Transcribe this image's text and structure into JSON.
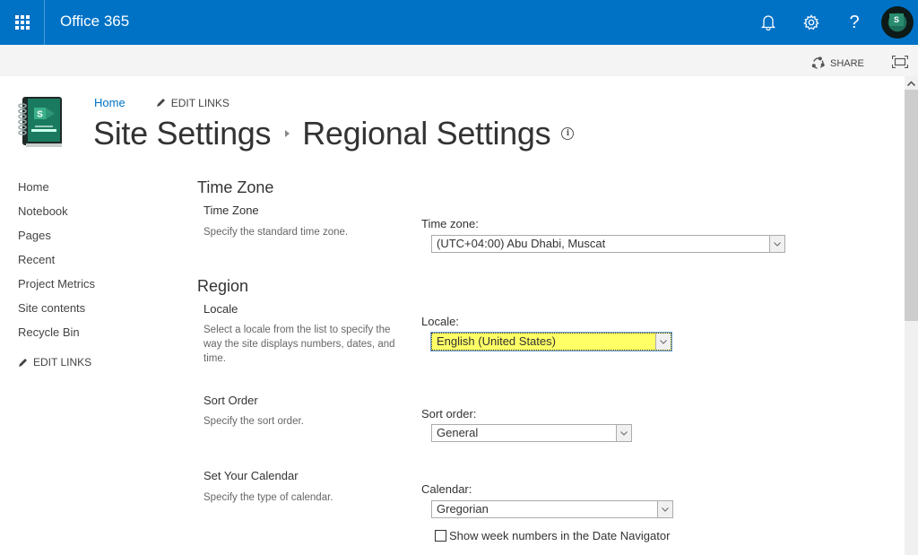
{
  "suitebar": {
    "app_title": "Office 365",
    "icons": [
      "waffle-icon",
      "bell-icon",
      "gear-icon",
      "help-icon",
      "avatar"
    ],
    "help_glyph": "?",
    "avatar_letter": "S"
  },
  "sharebar": {
    "share_label": "SHARE",
    "icons": [
      "share-icon",
      "focus-mode-icon"
    ]
  },
  "header": {
    "home_link": "Home",
    "edit_links_label": "EDIT LINKS",
    "breadcrumb_parent": "Site Settings",
    "page_title": "Regional Settings",
    "info_glyph": "i"
  },
  "leftnav": {
    "items": [
      {
        "label": "Home"
      },
      {
        "label": "Notebook"
      },
      {
        "label": "Pages"
      },
      {
        "label": "Recent"
      },
      {
        "label": "Project Metrics"
      },
      {
        "label": "Site contents"
      },
      {
        "label": "Recycle Bin"
      }
    ],
    "edit_links_label": "EDIT LINKS"
  },
  "content": {
    "time_zone": {
      "section_title": "Time Zone",
      "subtitle": "Time Zone",
      "description": "Specify the standard time zone.",
      "field_label": "Time zone:",
      "selected": "(UTC+04:00) Abu Dhabi, Muscat"
    },
    "region": {
      "section_title": "Region",
      "locale": {
        "subtitle": "Locale",
        "description": "Select a locale from the list to specify the way the site displays numbers, dates, and time.",
        "field_label": "Locale:",
        "selected": "English (United States)",
        "highlight_color": "#ffff66"
      },
      "sort_order": {
        "subtitle": "Sort Order",
        "description": "Specify the sort order.",
        "field_label": "Sort order:",
        "selected": "General"
      },
      "calendar": {
        "subtitle": "Set Your Calendar",
        "description": "Specify the type of calendar.",
        "field_label": "Calendar:",
        "selected": "Gregorian",
        "week_numbers_label": "Show week numbers in the Date Navigator",
        "week_numbers_checked": false
      }
    }
  },
  "colors": {
    "suitebar": "#0072c6",
    "link": "#0072c6",
    "sharebar": "#f4f4f4"
  }
}
